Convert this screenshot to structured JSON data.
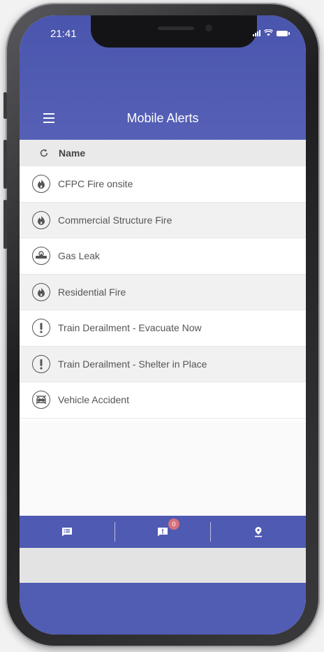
{
  "status_bar": {
    "time": "21:41"
  },
  "header": {
    "title": "Mobile Alerts"
  },
  "list": {
    "column_header": "Name",
    "items": [
      {
        "label": "CFPC Fire onsite",
        "icon": "fire-icon"
      },
      {
        "label": "Commercial Structure Fire",
        "icon": "fire-icon"
      },
      {
        "label": "Gas Leak",
        "icon": "gas-leak-icon"
      },
      {
        "label": "Residential Fire",
        "icon": "fire-icon"
      },
      {
        "label": "Train Derailment - Evacuate Now",
        "icon": "exclamation-icon"
      },
      {
        "label": "Train Derailment - Shelter in Place",
        "icon": "exclamation-icon"
      },
      {
        "label": "Vehicle Accident",
        "icon": "vehicle-accident-icon"
      }
    ]
  },
  "tabs": {
    "alerts_badge": "0",
    "items": [
      {
        "name": "messages-tab",
        "icon": "message-list-icon"
      },
      {
        "name": "alerts-tab",
        "icon": "alert-icon"
      },
      {
        "name": "location-tab",
        "icon": "location-pin-icon"
      }
    ]
  },
  "colors": {
    "header": "#4f5ab2",
    "row_alt": "#f1f1f1",
    "badge": "#d9707c"
  }
}
